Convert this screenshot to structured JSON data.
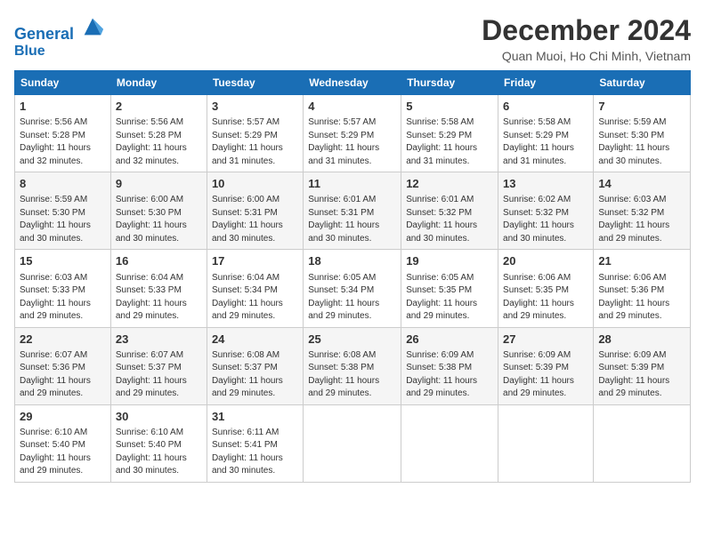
{
  "header": {
    "logo_line1": "General",
    "logo_line2": "Blue",
    "month_title": "December 2024",
    "location": "Quan Muoi, Ho Chi Minh, Vietnam"
  },
  "weekdays": [
    "Sunday",
    "Monday",
    "Tuesday",
    "Wednesday",
    "Thursday",
    "Friday",
    "Saturday"
  ],
  "weeks": [
    [
      {
        "day": "1",
        "info": "Sunrise: 5:56 AM\nSunset: 5:28 PM\nDaylight: 11 hours\nand 32 minutes."
      },
      {
        "day": "2",
        "info": "Sunrise: 5:56 AM\nSunset: 5:28 PM\nDaylight: 11 hours\nand 32 minutes."
      },
      {
        "day": "3",
        "info": "Sunrise: 5:57 AM\nSunset: 5:29 PM\nDaylight: 11 hours\nand 31 minutes."
      },
      {
        "day": "4",
        "info": "Sunrise: 5:57 AM\nSunset: 5:29 PM\nDaylight: 11 hours\nand 31 minutes."
      },
      {
        "day": "5",
        "info": "Sunrise: 5:58 AM\nSunset: 5:29 PM\nDaylight: 11 hours\nand 31 minutes."
      },
      {
        "day": "6",
        "info": "Sunrise: 5:58 AM\nSunset: 5:29 PM\nDaylight: 11 hours\nand 31 minutes."
      },
      {
        "day": "7",
        "info": "Sunrise: 5:59 AM\nSunset: 5:30 PM\nDaylight: 11 hours\nand 30 minutes."
      }
    ],
    [
      {
        "day": "8",
        "info": "Sunrise: 5:59 AM\nSunset: 5:30 PM\nDaylight: 11 hours\nand 30 minutes."
      },
      {
        "day": "9",
        "info": "Sunrise: 6:00 AM\nSunset: 5:30 PM\nDaylight: 11 hours\nand 30 minutes."
      },
      {
        "day": "10",
        "info": "Sunrise: 6:00 AM\nSunset: 5:31 PM\nDaylight: 11 hours\nand 30 minutes."
      },
      {
        "day": "11",
        "info": "Sunrise: 6:01 AM\nSunset: 5:31 PM\nDaylight: 11 hours\nand 30 minutes."
      },
      {
        "day": "12",
        "info": "Sunrise: 6:01 AM\nSunset: 5:32 PM\nDaylight: 11 hours\nand 30 minutes."
      },
      {
        "day": "13",
        "info": "Sunrise: 6:02 AM\nSunset: 5:32 PM\nDaylight: 11 hours\nand 30 minutes."
      },
      {
        "day": "14",
        "info": "Sunrise: 6:03 AM\nSunset: 5:32 PM\nDaylight: 11 hours\nand 29 minutes."
      }
    ],
    [
      {
        "day": "15",
        "info": "Sunrise: 6:03 AM\nSunset: 5:33 PM\nDaylight: 11 hours\nand 29 minutes."
      },
      {
        "day": "16",
        "info": "Sunrise: 6:04 AM\nSunset: 5:33 PM\nDaylight: 11 hours\nand 29 minutes."
      },
      {
        "day": "17",
        "info": "Sunrise: 6:04 AM\nSunset: 5:34 PM\nDaylight: 11 hours\nand 29 minutes."
      },
      {
        "day": "18",
        "info": "Sunrise: 6:05 AM\nSunset: 5:34 PM\nDaylight: 11 hours\nand 29 minutes."
      },
      {
        "day": "19",
        "info": "Sunrise: 6:05 AM\nSunset: 5:35 PM\nDaylight: 11 hours\nand 29 minutes."
      },
      {
        "day": "20",
        "info": "Sunrise: 6:06 AM\nSunset: 5:35 PM\nDaylight: 11 hours\nand 29 minutes."
      },
      {
        "day": "21",
        "info": "Sunrise: 6:06 AM\nSunset: 5:36 PM\nDaylight: 11 hours\nand 29 minutes."
      }
    ],
    [
      {
        "day": "22",
        "info": "Sunrise: 6:07 AM\nSunset: 5:36 PM\nDaylight: 11 hours\nand 29 minutes."
      },
      {
        "day": "23",
        "info": "Sunrise: 6:07 AM\nSunset: 5:37 PM\nDaylight: 11 hours\nand 29 minutes."
      },
      {
        "day": "24",
        "info": "Sunrise: 6:08 AM\nSunset: 5:37 PM\nDaylight: 11 hours\nand 29 minutes."
      },
      {
        "day": "25",
        "info": "Sunrise: 6:08 AM\nSunset: 5:38 PM\nDaylight: 11 hours\nand 29 minutes."
      },
      {
        "day": "26",
        "info": "Sunrise: 6:09 AM\nSunset: 5:38 PM\nDaylight: 11 hours\nand 29 minutes."
      },
      {
        "day": "27",
        "info": "Sunrise: 6:09 AM\nSunset: 5:39 PM\nDaylight: 11 hours\nand 29 minutes."
      },
      {
        "day": "28",
        "info": "Sunrise: 6:09 AM\nSunset: 5:39 PM\nDaylight: 11 hours\nand 29 minutes."
      }
    ],
    [
      {
        "day": "29",
        "info": "Sunrise: 6:10 AM\nSunset: 5:40 PM\nDaylight: 11 hours\nand 29 minutes."
      },
      {
        "day": "30",
        "info": "Sunrise: 6:10 AM\nSunset: 5:40 PM\nDaylight: 11 hours\nand 30 minutes."
      },
      {
        "day": "31",
        "info": "Sunrise: 6:11 AM\nSunset: 5:41 PM\nDaylight: 11 hours\nand 30 minutes."
      },
      null,
      null,
      null,
      null
    ]
  ]
}
